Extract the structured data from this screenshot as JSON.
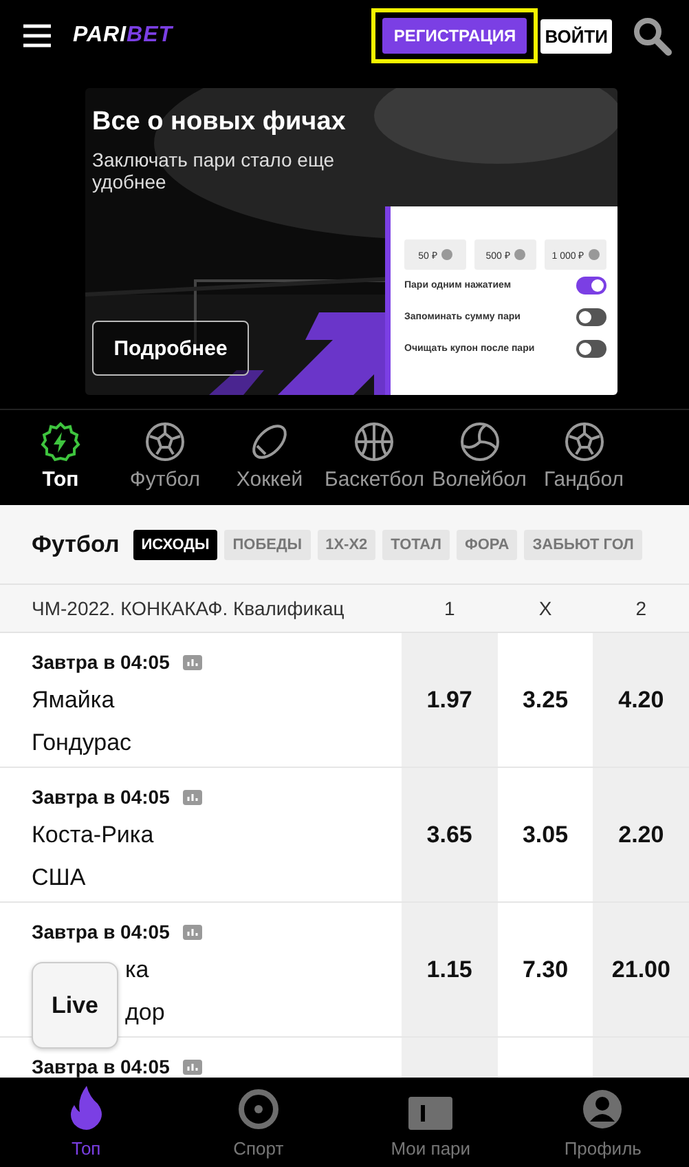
{
  "header": {
    "logo": {
      "part_1": "PARI",
      "part_2": "BET"
    },
    "register_button": "РЕГИСТРАЦИЯ",
    "register_highlighted": true,
    "login_button": "ВОЙТИ"
  },
  "banner": {
    "title": "Все о новых фичах",
    "subtitle": "Заключать пари стало еще удобнее",
    "button": "Подробнее",
    "amounts": [
      "50 ₽",
      "500 ₽",
      "1 000 ₽"
    ],
    "settings": [
      {
        "label": "Пари одним нажатием",
        "on": true
      },
      {
        "label": "Запоминать сумму пари",
        "on": false
      },
      {
        "label": "Очищать купон после пари",
        "on": false
      }
    ]
  },
  "sport_tabs": [
    {
      "label": "Топ",
      "kind": "top",
      "selected": true
    },
    {
      "label": "Футбол",
      "kind": "football",
      "selected": false
    },
    {
      "label": "Хоккей",
      "kind": "hockey",
      "selected": false
    },
    {
      "label": "Баскетбол",
      "kind": "basketball",
      "selected": false
    },
    {
      "label": "Волейбол",
      "kind": "volleyball",
      "selected": false
    },
    {
      "label": "Гандбол",
      "kind": "handball",
      "selected": false
    }
  ],
  "markets": {
    "title": "Футбол",
    "chips": [
      {
        "label": "ИСХОДЫ",
        "selected": true
      },
      {
        "label": "ПОБЕДЫ",
        "selected": false
      },
      {
        "label": "1X-X2",
        "selected": false
      },
      {
        "label": "ТОТАЛ",
        "selected": false
      },
      {
        "label": "ФОРА",
        "selected": false
      },
      {
        "label": "ЗАБЬЮТ ГОЛ",
        "selected": false
      }
    ]
  },
  "league": {
    "name": "ЧМ-2022. КОНКАКАФ. Квалификац",
    "columns": [
      "1",
      "X",
      "2"
    ]
  },
  "matches": [
    {
      "time": "Завтра в 04:05",
      "teams": [
        "Ямайка",
        "Гондурас"
      ],
      "odds": [
        "1.97",
        "3.25",
        "4.20"
      ]
    },
    {
      "time": "Завтра в 04:05",
      "teams": [
        "Коста-Рика",
        "США"
      ],
      "odds": [
        "3.65",
        "3.05",
        "2.20"
      ]
    },
    {
      "time": "Завтра в 04:05",
      "teams": [
        "ка",
        "дор"
      ],
      "partial": true,
      "odds": [
        "1.15",
        "7.30",
        "21.00"
      ]
    },
    {
      "time": "Завтра в 04:05"
    }
  ],
  "live_button": "Live",
  "bottom_nav": [
    {
      "label": "Топ",
      "kind": "top",
      "selected": true
    },
    {
      "label": "Спорт",
      "kind": "sport",
      "selected": false
    },
    {
      "label": "Мои пари",
      "kind": "bets",
      "selected": false
    },
    {
      "label": "Профиль",
      "kind": "profile",
      "selected": false
    }
  ]
}
